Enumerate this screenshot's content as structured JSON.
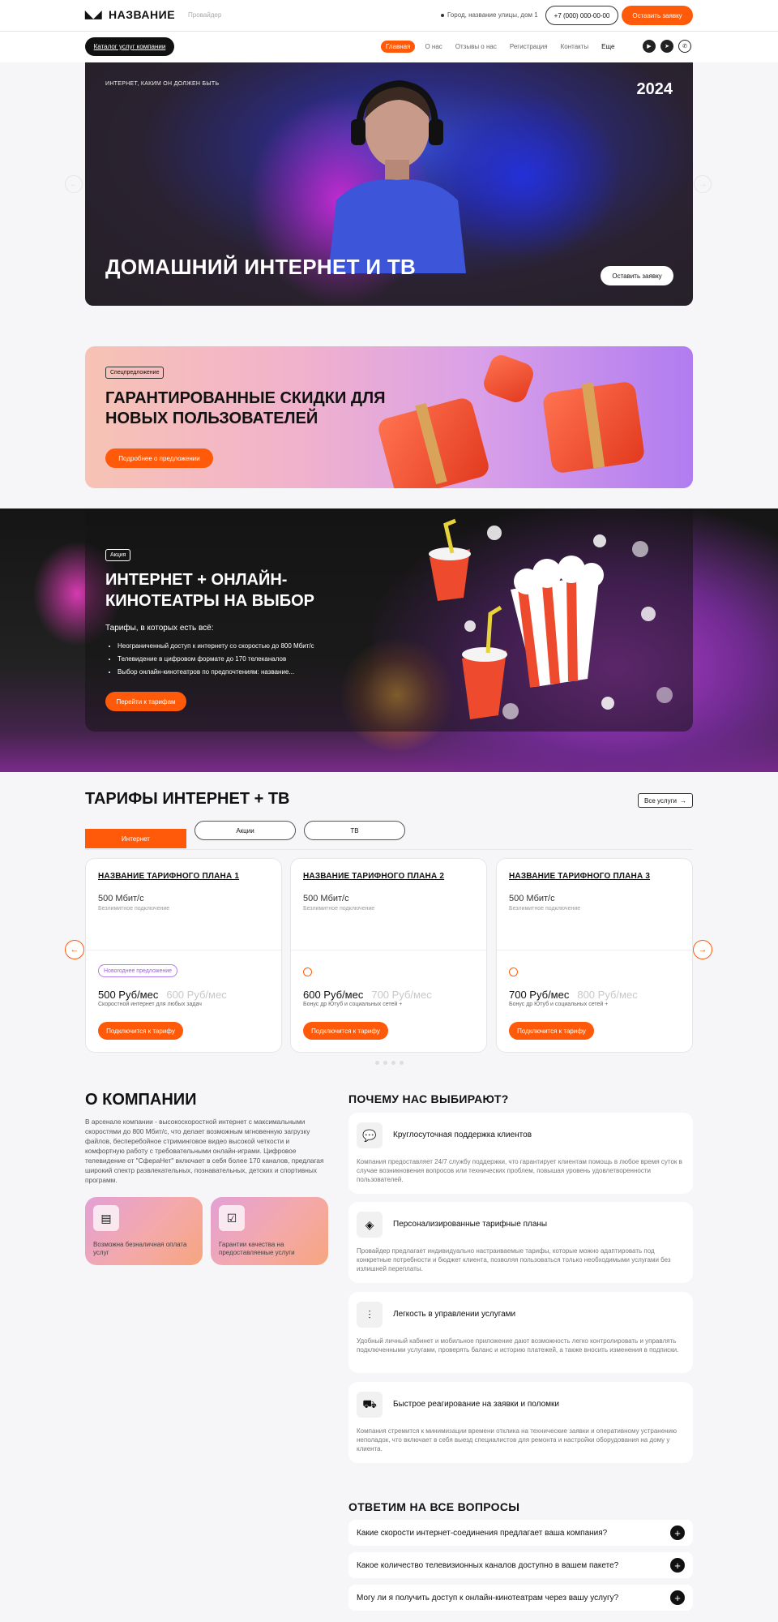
{
  "header": {
    "logo_mark": "◣◢",
    "brand": "НАЗВАНИЕ",
    "slogan": "Провайдер",
    "address": "Город, название улицы, дом 1",
    "phone": "+7 (000) 000-00-00",
    "cta": "Оставить заявку"
  },
  "nav": {
    "catalog": "Каталог услуг компании",
    "items": [
      "Главная",
      "О нас",
      "Отзывы о нас",
      "Регистрация",
      "Контакты",
      "Еще"
    ],
    "active": "Главная",
    "social": [
      "youtube-icon",
      "telegram-icon",
      "whatsapp-icon"
    ]
  },
  "hero": {
    "kicker": "ИНТЕРНЕТ, КАКИМ ОН ДОЛЖЕН БЫТЬ",
    "year": "2024",
    "title": "ДОМАШНИЙ ИНТЕРНЕТ И ТВ",
    "button": "Оставить заявку"
  },
  "promo": {
    "tag": "Спецпредложение",
    "title": "ГАРАНТИРОВАННЫЕ СКИДКИ ДЛЯ НОВЫХ ПОЛЬЗОВАТЕЛЕЙ",
    "button": "Подробнее о предложении"
  },
  "cinema": {
    "tag": "Акция",
    "title": "ИНТЕРНЕТ + ОНЛАЙН-КИНОТЕАТРЫ НА ВЫБОР",
    "subtitle": "Тарифы, в которых есть всё:",
    "bullets": [
      "Неограниченный доступ к интернету со скоростью до 800 Мбит/с",
      "Телевидение в цифровом формате до 170 телеканалов",
      "Выбор онлайн-кинотеатров по предпочтениям: название..."
    ],
    "button": "Перейти к тарифам"
  },
  "tariffs": {
    "title": "ТАРИФЫ ИНТЕРНЕТ + ТВ",
    "all_services": "Все услуги",
    "tabs": [
      "Интернет",
      "Акции",
      "ТВ"
    ],
    "active_tab": "Интернет",
    "cards": [
      {
        "name": "НАЗВАНИЕ ТАРИФНОГО ПЛАНА 1",
        "speed": "500 Мбит/с",
        "desc": "Безлимитное подключение",
        "badge": "Новогоднее предложение",
        "price": "500 Руб/мес",
        "old_price": "600 Руб/мес",
        "note": "Скоростной интернет для любых задач",
        "button": "Подключится к тарифу"
      },
      {
        "name": "НАЗВАНИЕ ТАРИФНОГО ПЛАНА 2",
        "speed": "500 Мбит/с",
        "desc": "Безлимитное подключение",
        "badge": "",
        "price": "600 Руб/мес",
        "old_price": "700 Руб/мес",
        "note": "Бонус др Ютуб и социальных сетей +",
        "button": "Подключится к тарифу"
      },
      {
        "name": "НАЗВАНИЕ ТАРИФНОГО ПЛАНА 3",
        "speed": "500 Мбит/с",
        "desc": "Безлимитное подключение",
        "badge": "",
        "price": "700 Руб/мес",
        "old_price": "800 Руб/мес",
        "note": "Бонус др Ютуб и социальных сетей +",
        "button": "Подключится к тарифу"
      }
    ]
  },
  "about": {
    "title": "О КОМПАНИИ",
    "text": "В арсенале компании - высокоскоростной интернет с максимальными скоростями до 800 Мбит/с, что делает возможным мгновенную загрузку файлов, бесперебойное стриминговое видео высокой четкости и комфортную работу с требовательными онлайн-играми. Цифровое телевидение от \"СфераНет\" включает в себя более 170 каналов, предлагая широкий спектр развлекательных, познавательных, детских и спортивных программ.",
    "features": [
      {
        "icon": "payment-icon",
        "label": "Возможна безналичная оплата услуг"
      },
      {
        "icon": "certificate-icon",
        "label": "Гарантии качества на предоставляемые услуги"
      }
    ]
  },
  "why": {
    "title": "ПОЧЕМУ НАС ВЫБИРАЮТ?",
    "items": [
      {
        "icon": "chat-icon",
        "title": "Круглосуточная поддержка клиентов",
        "text": "Компания предоставляет 24/7 службу поддержки, что гарантирует клиентам помощь в любое время суток в случае возникновения вопросов или технических проблем, повышая уровень удовлетворенности пользователей."
      },
      {
        "icon": "layers-icon",
        "title": "Персонализированные тарифные планы",
        "text": "Провайдер предлагает индивидуально настраиваемые тарифы, которые можно адаптировать под конкретные потребности и бюджет клиента, позволяя пользоваться только необходимыми услугами без излишней переплаты."
      },
      {
        "icon": "sliders-icon",
        "title": "Легкость в управлении услугами",
        "text": "Удобный личный кабинет и мобильное приложение дают возможность легко контролировать и управлять подключенными услугами, проверять баланс и историю платежей, а также вносить изменения в подписки."
      },
      {
        "icon": "truck-icon",
        "title": "Быстрое реагирование на заявки и поломки",
        "text": "Компания стремится к минимизации времени отклика на технические заявки и оперативному устранению неполадок, что включает в себя выезд специалистов для ремонта и настройки оборудования на дому у клиента."
      }
    ]
  },
  "faq": {
    "title": "ОТВЕТИМ НА ВСЕ ВОПРОСЫ",
    "items": [
      "Какие скорости интернет-соединения предлагает ваша компания?",
      "Какое количество телевизионных каналов доступно в вашем пакете?",
      "Могу ли я получить доступ к онлайн-кинотеатрам через вашу услугу?"
    ]
  }
}
